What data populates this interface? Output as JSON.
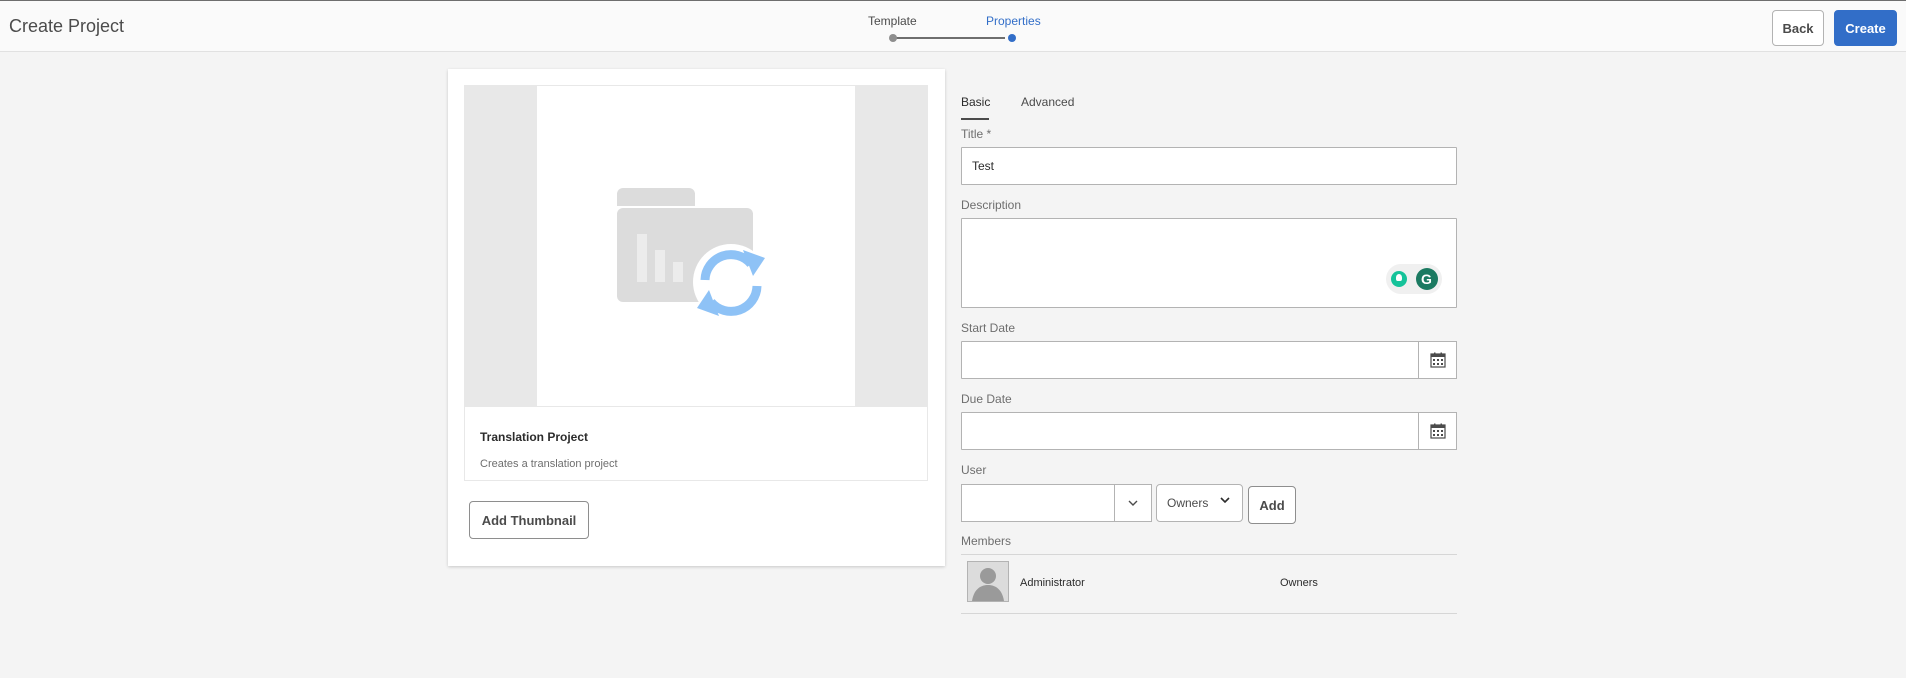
{
  "header": {
    "title": "Create Project",
    "steps": [
      {
        "label": "Template",
        "state": "done"
      },
      {
        "label": "Properties",
        "state": "current"
      }
    ],
    "back_label": "Back",
    "create_label": "Create"
  },
  "template_card": {
    "title": "Translation Project",
    "description": "Creates a translation project",
    "add_thumbnail_label": "Add Thumbnail"
  },
  "tabs": [
    {
      "label": "Basic",
      "active": true
    },
    {
      "label": "Advanced",
      "active": false
    }
  ],
  "form": {
    "title_label": "Title *",
    "title_value": "Test",
    "description_label": "Description",
    "description_value": "",
    "start_date_label": "Start Date",
    "start_date_value": "",
    "due_date_label": "Due Date",
    "due_date_value": "",
    "user_label": "User",
    "user_value": "",
    "role_value": "Owners",
    "add_label": "Add",
    "members_label": "Members",
    "members": [
      {
        "name": "Administrator",
        "role": "Owners"
      }
    ]
  },
  "colors": {
    "accent": "#326ec8",
    "background": "#f4f4f4",
    "sync_icon": "#8ec2f6"
  }
}
